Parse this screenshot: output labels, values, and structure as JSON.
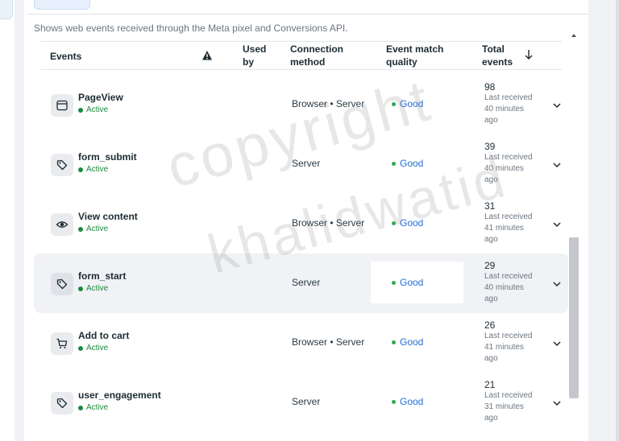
{
  "subtitle": "Shows web events received through the Meta pixel and Conversions API.",
  "table": {
    "headers": {
      "events": "Events",
      "used_by": "Used by",
      "connection_method": "Connection method",
      "event_match_quality": "Event match quality",
      "total_events": "Total events"
    },
    "rows": [
      {
        "icon": "page-icon",
        "name": "PageView",
        "status": "Active",
        "connection": "Browser • Server",
        "quality": "Good",
        "count": "98",
        "last": "Last received 40 minutes ago"
      },
      {
        "icon": "tag-icon",
        "name": "form_submit",
        "status": "Active",
        "connection": "Server",
        "quality": "Good",
        "count": "39",
        "last": "Last received 40 minutes ago"
      },
      {
        "icon": "eye-icon",
        "name": "View content",
        "status": "Active",
        "connection": "Browser • Server",
        "quality": "Good",
        "count": "31",
        "last": "Last received 41 minutes ago"
      },
      {
        "icon": "tag-icon",
        "name": "form_start",
        "status": "Active",
        "connection": "Server",
        "quality": "Good",
        "count": "29",
        "last": "Last received 40 minutes ago"
      },
      {
        "icon": "cart-icon",
        "name": "Add to cart",
        "status": "Active",
        "connection": "Browser • Server",
        "quality": "Good",
        "count": "26",
        "last": "Last received 41 minutes ago"
      },
      {
        "icon": "tag-icon",
        "name": "user_engagement",
        "status": "Active",
        "connection": "Server",
        "quality": "Good",
        "count": "21",
        "last": "Last received 31 minutes ago"
      }
    ]
  },
  "watermark": {
    "line1": "copyright",
    "line2": "khalidwatid"
  },
  "colors": {
    "active": "#1c8a3e",
    "good_dot": "#34a853",
    "good_text": "#216fdb"
  }
}
